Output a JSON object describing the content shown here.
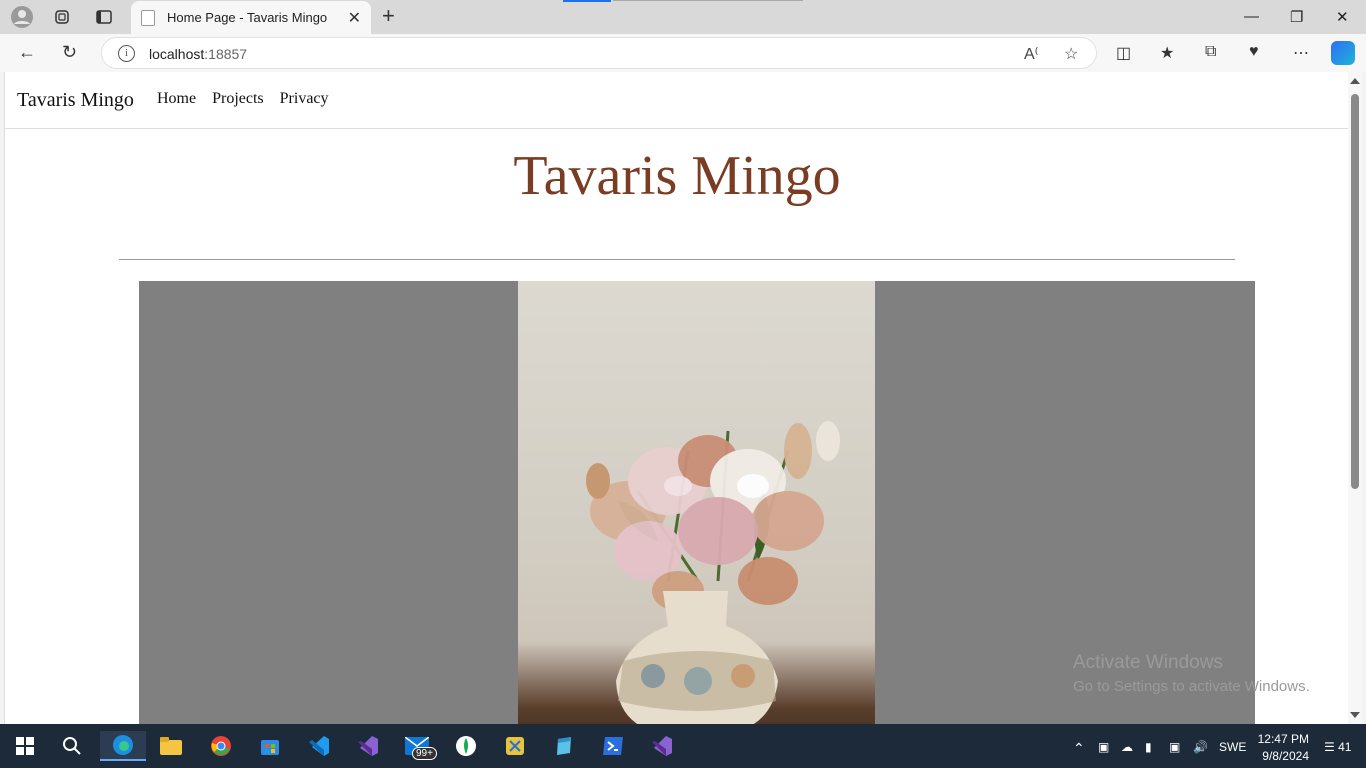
{
  "browser": {
    "tab_title": "Home Page - Tavaris Mingo",
    "url_host": "localhost",
    "url_port": ":18857",
    "new_tab": "+",
    "close_tab": "✕"
  },
  "site": {
    "brand": "Tavaris Mingo",
    "nav": [
      "Home",
      "Projects",
      "Privacy"
    ],
    "hero_title": "Tavaris Mingo"
  },
  "watermark": {
    "line1": "Activate Windows",
    "line2": "Go to Settings to activate Windows."
  },
  "taskbar": {
    "mail_badge": "99+",
    "language": "SWE",
    "time": "12:47 PM",
    "date": "9/8/2024",
    "notifications": "41"
  },
  "colors": {
    "hero_title": "#7a3c22",
    "image_backdrop": "#808080",
    "taskbar": "#1c2a3a"
  }
}
